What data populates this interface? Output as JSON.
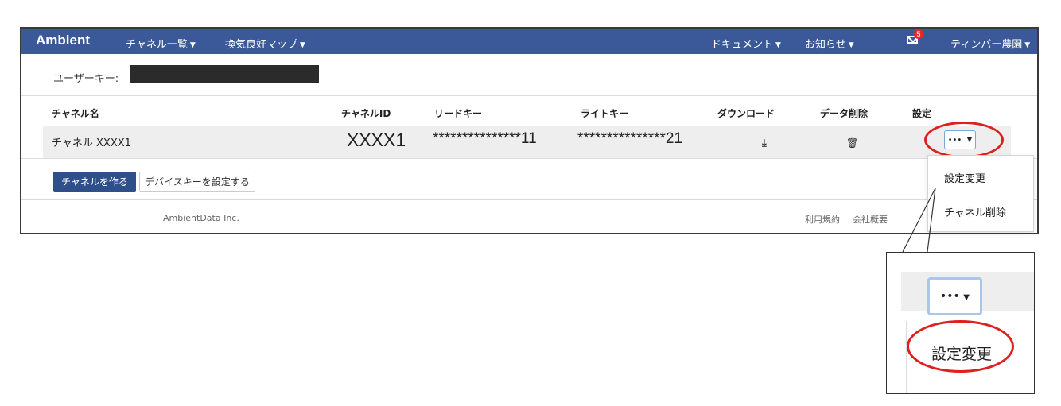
{
  "navbar": {
    "brand": "Ambient",
    "channel_list": "チャネル一覧",
    "ventilation_map": "換気良好マップ",
    "documents": "ドキュメント",
    "notices": "お知らせ",
    "mail_badge": "5",
    "user": "ティンバー農園",
    "color": "#3b5998"
  },
  "userkey": {
    "label": "ユーザーキー:"
  },
  "table": {
    "headers": [
      "チャネル名",
      "チャネルID",
      "リードキー",
      "ライトキー",
      "ダウンロード",
      "データ削除",
      "設定"
    ],
    "row": {
      "name": "チャネル XXXX1",
      "id": "XXXX1",
      "read_key": "***************11",
      "write_key": "***************21",
      "download_icon": "download-icon",
      "delete_icon": "trash-icon",
      "settings_label": "•••"
    }
  },
  "actions": {
    "create_channel": "チャネルを作る",
    "set_device_key": "デバイスキーを設定する"
  },
  "footer": {
    "company": "AmbientData Inc.",
    "terms": "利用規約",
    "about": "会社概要"
  },
  "dropdown": {
    "items": [
      "設定変更",
      "チャネル削除"
    ]
  },
  "zoom": {
    "button_label": "•••",
    "item": "設定変更"
  },
  "colors": {
    "highlight": "#e02020",
    "primary_button": "#2f4f8a"
  }
}
